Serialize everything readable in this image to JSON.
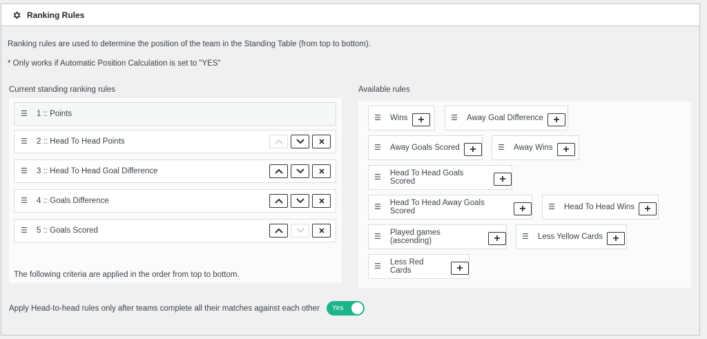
{
  "header": {
    "title": "Ranking Rules"
  },
  "descriptions": {
    "line1": "Ranking rules are used to determine the position of the team in the Standing Table (from top to bottom).",
    "line2": "* Only works if Automatic Position Calculation is set to \"YES\""
  },
  "current": {
    "label": "Current standing ranking rules",
    "rules": [
      {
        "label": "1 :: Points"
      },
      {
        "label": "2 :: Head To Head Points"
      },
      {
        "label": "3 :: Head To Head Goal Difference"
      },
      {
        "label": "4 :: Goals Difference"
      },
      {
        "label": "5 :: Goals Scored"
      }
    ],
    "footer": "The following criteria are applied in the order from top to bottom."
  },
  "available": {
    "label": "Available rules",
    "items": [
      {
        "label": "Wins"
      },
      {
        "label": "Away Goal Difference"
      },
      {
        "label": "Away Goals Scored"
      },
      {
        "label": "Away Wins"
      },
      {
        "label": "Head To Head Goals Scored"
      },
      {
        "label": "Head To Head Away Goals Scored"
      },
      {
        "label": "Head To Head Wins"
      },
      {
        "label": "Played games (ascending)"
      },
      {
        "label": "Less Yellow Cards"
      },
      {
        "label": "Less Red Cards"
      }
    ]
  },
  "toggle": {
    "label": "Apply Head-to-head rules only after teams complete all their matches against each other",
    "state": "Yes"
  },
  "colors": {
    "accent": "#1db48a",
    "border": "#c3c4c7",
    "button_border": "#2c3338"
  },
  "icons": {
    "header": "gear-icon",
    "drag": "drag-handle-icon",
    "up": "chevron-up-icon",
    "down": "chevron-down-icon",
    "remove": "close-icon",
    "add": "plus-icon"
  }
}
